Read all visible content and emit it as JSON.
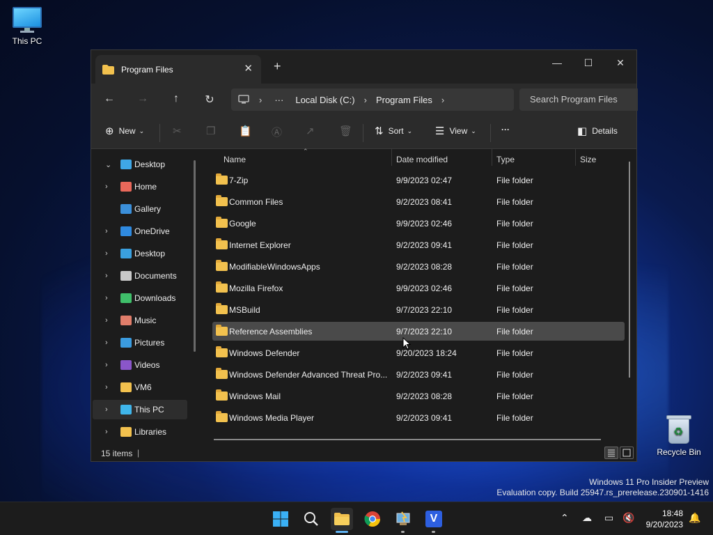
{
  "desktop": {
    "this_pc_label": "This PC",
    "recycle_bin_label": "Recycle Bin"
  },
  "window": {
    "tab_title": "Program Files",
    "new_tab": "+",
    "tab_close": "✕",
    "minimize": "—",
    "maximize": "☐",
    "close": "✕"
  },
  "nav": {
    "back": "←",
    "forward": "→",
    "up": "↑",
    "refresh": "↻",
    "breadcrumb": [
      "Local Disk (C:)",
      "Program Files"
    ],
    "more": "···",
    "search_placeholder": "Search Program Files"
  },
  "toolbar": {
    "new_label": "New",
    "sort_label": "Sort",
    "view_label": "View",
    "more_label": "···",
    "details_label": "Details"
  },
  "sidebar": {
    "items": [
      {
        "label": "Desktop",
        "icon": "desktop-icon",
        "chevron": "⌄",
        "color": "#3fa7e6"
      },
      {
        "label": "Home",
        "icon": "home-icon",
        "chevron": "›",
        "color": "#e9685a"
      },
      {
        "label": "Gallery",
        "icon": "gallery-icon",
        "chevron": "",
        "color": "#3b8fd9"
      },
      {
        "label": "OneDrive",
        "icon": "onedrive-icon",
        "chevron": "›",
        "color": "#2f8ae0"
      },
      {
        "label": "Desktop",
        "icon": "desktop-icon",
        "chevron": "›",
        "color": "#3aa0e0"
      },
      {
        "label": "Documents",
        "icon": "documents-icon",
        "chevron": "›",
        "color": "#c9c9c9"
      },
      {
        "label": "Downloads",
        "icon": "downloads-icon",
        "chevron": "›",
        "color": "#3fbf6a"
      },
      {
        "label": "Music",
        "icon": "music-icon",
        "chevron": "›",
        "color": "#e07d6a"
      },
      {
        "label": "Pictures",
        "icon": "pictures-icon",
        "chevron": "›",
        "color": "#3b9ce0"
      },
      {
        "label": "Videos",
        "icon": "videos-icon",
        "chevron": "›",
        "color": "#8a56c9"
      },
      {
        "label": "VM6",
        "icon": "folder-icon",
        "chevron": "›",
        "color": "#f2c14e"
      },
      {
        "label": "This PC",
        "icon": "this-pc-icon",
        "chevron": "›",
        "color": "#3fb5ea"
      },
      {
        "label": "Libraries",
        "icon": "libraries-icon",
        "chevron": "›",
        "color": "#f2c14e"
      }
    ],
    "active_index": 11
  },
  "columns": {
    "name": "Name",
    "date": "Date modified",
    "type": "Type",
    "size": "Size"
  },
  "files": [
    {
      "name": "7-Zip",
      "date": "9/9/2023 02:47",
      "type": "File folder"
    },
    {
      "name": "Common Files",
      "date": "9/2/2023 08:41",
      "type": "File folder"
    },
    {
      "name": "Google",
      "date": "9/9/2023 02:46",
      "type": "File folder"
    },
    {
      "name": "Internet Explorer",
      "date": "9/2/2023 09:41",
      "type": "File folder"
    },
    {
      "name": "ModifiableWindowsApps",
      "date": "9/2/2023 08:28",
      "type": "File folder"
    },
    {
      "name": "Mozilla Firefox",
      "date": "9/9/2023 02:46",
      "type": "File folder"
    },
    {
      "name": "MSBuild",
      "date": "9/7/2023 22:10",
      "type": "File folder"
    },
    {
      "name": "Reference Assemblies",
      "date": "9/7/2023 22:10",
      "type": "File folder"
    },
    {
      "name": "Windows Defender",
      "date": "9/20/2023 18:24",
      "type": "File folder"
    },
    {
      "name": "Windows Defender Advanced Threat Pro...",
      "date": "9/2/2023 09:41",
      "type": "File folder"
    },
    {
      "name": "Windows Mail",
      "date": "9/2/2023 08:28",
      "type": "File folder"
    },
    {
      "name": "Windows Media Player",
      "date": "9/2/2023 09:41",
      "type": "File folder"
    }
  ],
  "selected_file_index": 7,
  "status": {
    "items_count": "15 items"
  },
  "watermark": {
    "line1": "Windows 11 Pro Insider Preview",
    "line2": "Evaluation copy. Build 25947.rs_prerelease.230901-1416"
  },
  "taskbar": {
    "time": "18:48",
    "date": "9/20/2023"
  }
}
